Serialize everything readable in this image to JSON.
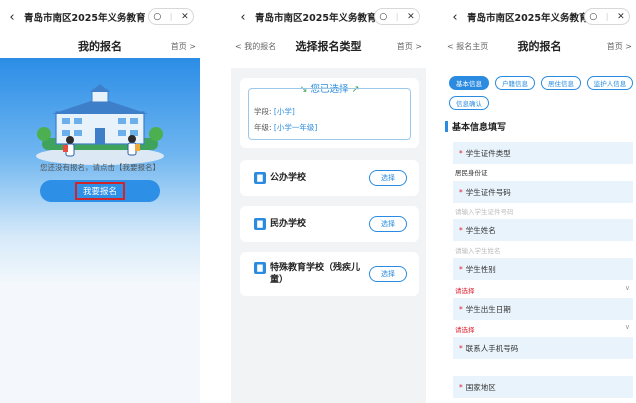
{
  "app_title": "青岛市南区2025年义务教育",
  "capsule": {
    "more": "○",
    "close": "✕"
  },
  "screen1": {
    "page_title": "我的报名",
    "home_link": "首页 >",
    "empty_text": "您还没有报名，请点击【我要报名】",
    "enroll_button": "我要报名"
  },
  "screen2": {
    "back_link": "< 我的报名",
    "page_title": "选择报名类型",
    "home_link": "首页 >",
    "selected_title": "您已选择",
    "stage_label": "学段:",
    "stage_value": "[小学]",
    "grade_label": "年级:",
    "grade_value": "[小学一年级]",
    "options": [
      {
        "label": "公办学校",
        "button": "选择"
      },
      {
        "label": "民办学校",
        "button": "选择"
      },
      {
        "label": "特殊教育学校（残疾儿童）",
        "button": "选择"
      }
    ]
  },
  "screen3": {
    "back_link": "< 报名主页",
    "page_title": "我的报名",
    "home_link": "首页 >",
    "tabs": [
      "基本信息",
      "户籍信息",
      "居住信息",
      "监护人信息",
      "信息确认"
    ],
    "section_title": "基本信息填写",
    "fields": [
      {
        "label": "学生证件类型",
        "value": "居民身份证",
        "value_style": "dark"
      },
      {
        "label": "学生证件号码",
        "value": "请输入学生证件号码",
        "value_style": "gray"
      },
      {
        "label": "学生姓名",
        "value": "请输入学生姓名",
        "value_style": "gray"
      },
      {
        "label": "学生性别",
        "value": "请选择",
        "value_style": "red"
      },
      {
        "label": "学生出生日期",
        "value": "请选择",
        "value_style": "red"
      },
      {
        "label": "联系人手机号码",
        "value": "",
        "value_style": "gray"
      },
      {
        "label": "国家地区",
        "value": "",
        "value_style": "gray"
      }
    ],
    "required_mark": "*"
  },
  "colors": {
    "primary": "#2a8be0",
    "required": "#dd2233",
    "highlight_border": "#d0262b"
  }
}
